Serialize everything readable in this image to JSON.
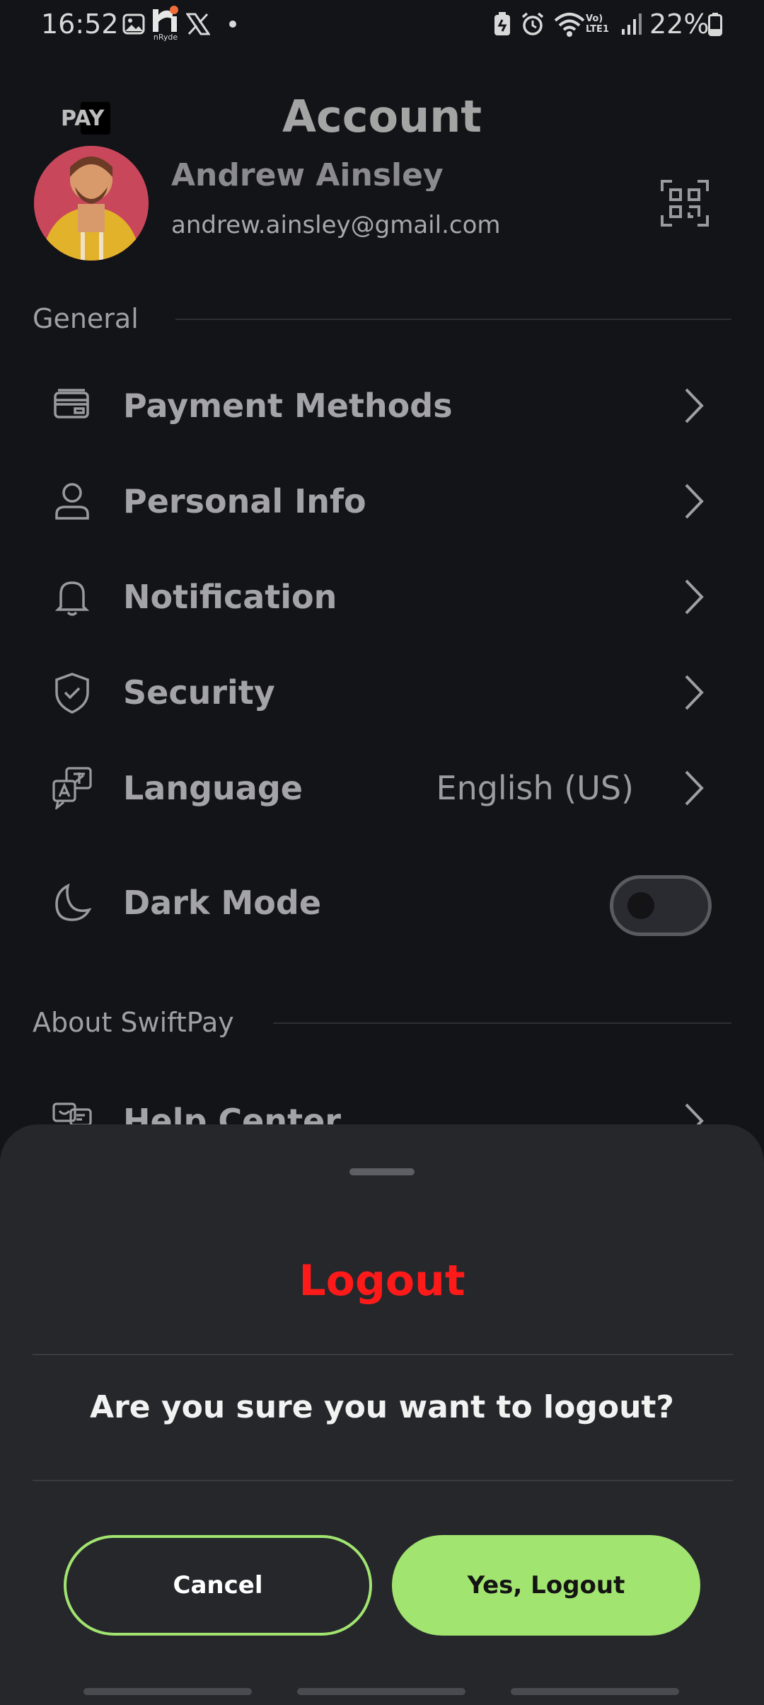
{
  "status_bar": {
    "time": "16:52",
    "notification_icons": [
      "gallery-icon",
      "nryde-app-icon",
      "x-app-icon",
      "dot-icon"
    ],
    "nryde_label": "nRyde",
    "system_icons": [
      "battery-saver-icon",
      "alarm-icon",
      "wifi-icon",
      "volte-icon",
      "signal-icon",
      "battery-icon"
    ],
    "volte_label": "Vo) LTE1",
    "battery": "22%"
  },
  "header": {
    "logo_text": "PAY",
    "title": "Account"
  },
  "profile": {
    "name": "Andrew Ainsley",
    "email": "andrew.ainsley@gmail.com"
  },
  "general": {
    "section_label": "General",
    "items": [
      {
        "label": "Payment Methods",
        "icon": "credit-card-icon"
      },
      {
        "label": "Personal Info",
        "icon": "user-icon"
      },
      {
        "label": "Notification",
        "icon": "bell-icon"
      },
      {
        "label": "Security",
        "icon": "shield-check-icon"
      },
      {
        "label": "Language",
        "icon": "translate-icon",
        "value": "English (US)"
      }
    ],
    "dark_mode": {
      "label": "Dark Mode",
      "icon": "moon-icon",
      "enabled": false
    }
  },
  "about": {
    "section_label": "About SwiftPay",
    "items": [
      {
        "label": "Help Center",
        "icon": "help-chat-icon"
      }
    ]
  },
  "logout_sheet": {
    "title": "Logout",
    "question": "Are you sure you want to logout?",
    "cancel_label": "Cancel",
    "confirm_label": "Yes, Logout"
  },
  "colors": {
    "background": "#131418",
    "sheet": "#26272b",
    "accent": "#a1e46f",
    "danger": "#ff1a1a"
  }
}
